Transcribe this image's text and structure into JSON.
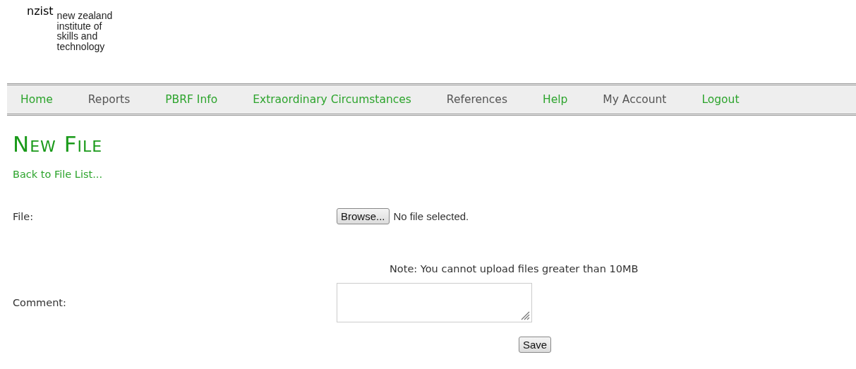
{
  "logo": {
    "wordmark": "nzist",
    "lines": [
      "new zealand",
      "institute of",
      "skills and",
      "technology"
    ]
  },
  "nav": [
    {
      "label": "Home",
      "visited": false
    },
    {
      "label": "Reports",
      "visited": true
    },
    {
      "label": "PBRF Info",
      "visited": false
    },
    {
      "label": "Extraordinary Circumstances",
      "visited": false
    },
    {
      "label": "References",
      "visited": true
    },
    {
      "label": "Help",
      "visited": false
    },
    {
      "label": "My Account",
      "visited": true
    },
    {
      "label": "Logout",
      "visited": false
    }
  ],
  "heading": "New File",
  "back_link": "Back to File List...",
  "file_row": {
    "label": "File:",
    "button": "Browse...",
    "status": "No file selected."
  },
  "note": "Note: You cannot upload files greater than 10MB",
  "comment_row": {
    "label": "Comment:"
  },
  "save_button": "Save"
}
